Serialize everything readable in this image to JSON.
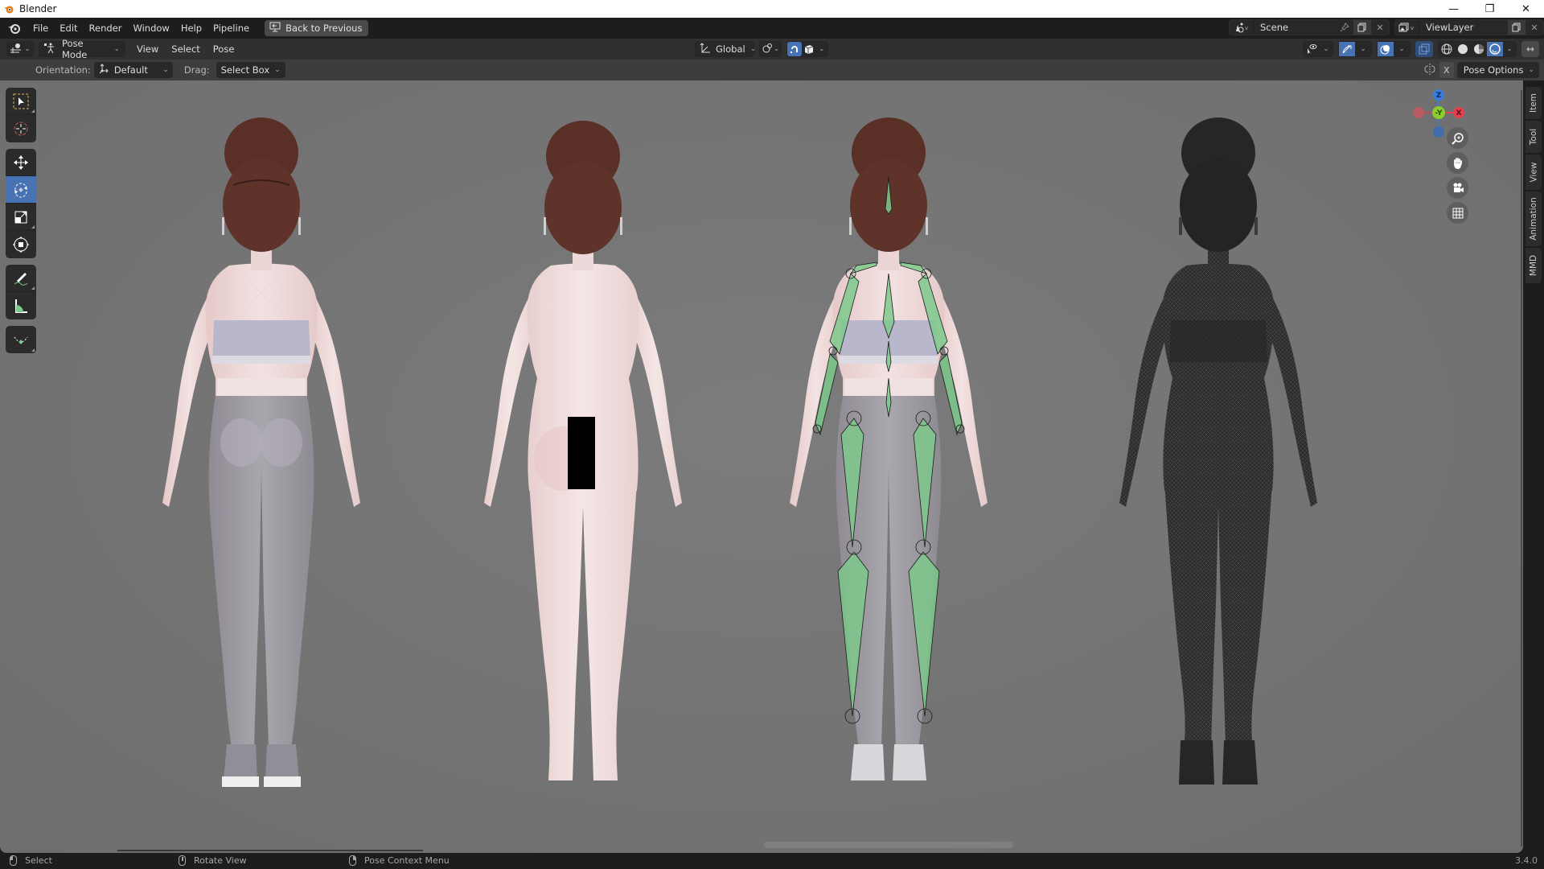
{
  "window": {
    "title": "Blender",
    "controls": {
      "minimize": "—",
      "maximize": "❐",
      "close": "✕"
    }
  },
  "menubar": {
    "items": [
      "File",
      "Edit",
      "Render",
      "Window",
      "Help",
      "Pipeline"
    ],
    "back_button": "Back to Previous",
    "scene": {
      "icon": "scene-icon",
      "value": "Scene"
    },
    "view_layer": {
      "icon": "view-layer-icon",
      "value": "ViewLayer"
    }
  },
  "header": {
    "editor_type_icon": "3d-viewport-icon",
    "mode": "Pose Mode",
    "menus": [
      "View",
      "Select",
      "Pose"
    ],
    "transform_orientation": "Global",
    "pivot_icon": "pivot-point-icon",
    "snap_active": true,
    "snap_target_icon": "cube-icon",
    "shading_modes": [
      "wireframe",
      "solid",
      "material-preview",
      "rendered"
    ],
    "active_shading": "rendered"
  },
  "tool_settings": {
    "orientation_label": "Orientation:",
    "orientation_value": "Default",
    "drag_label": "Drag:",
    "drag_value": "Select Box",
    "x_mirror": "X",
    "pose_options": "Pose Options"
  },
  "toolbar": {
    "groups": [
      [
        {
          "name": "select-box",
          "active": false
        },
        {
          "name": "cursor",
          "active": false
        }
      ],
      [
        {
          "name": "move",
          "active": false
        },
        {
          "name": "rotate",
          "active": true
        },
        {
          "name": "scale",
          "active": false
        },
        {
          "name": "transform",
          "active": false
        }
      ],
      [
        {
          "name": "annotate",
          "active": false
        },
        {
          "name": "measure",
          "active": false
        }
      ],
      [
        {
          "name": "bend",
          "active": false
        }
      ]
    ]
  },
  "viewport": {
    "figures": [
      {
        "label": "clothed-figure",
        "shading": "rendered"
      },
      {
        "label": "body-figure",
        "shading": "rendered",
        "censor_bar": true
      },
      {
        "label": "rigged-figure",
        "shading": "rendered",
        "armature": true
      },
      {
        "label": "wireframe-figure",
        "shading": "wireframe"
      }
    ],
    "gizmo_axes": {
      "z": "Z",
      "y": "-Y",
      "x": "X"
    },
    "colors": {
      "x_axis": "#e5404f",
      "y_axis": "#8bcf2f",
      "z_axis": "#3a7de0",
      "bone_fill": "#7ec98c",
      "accent": "#4772b3"
    }
  },
  "sidebar_tabs": [
    "Item",
    "Tool",
    "View",
    "Animation",
    "MMD"
  ],
  "statusbar": {
    "left_click": "Select",
    "middle_click": "Rotate View",
    "right_click": "Pose Context Menu",
    "version": "3.4.0"
  }
}
